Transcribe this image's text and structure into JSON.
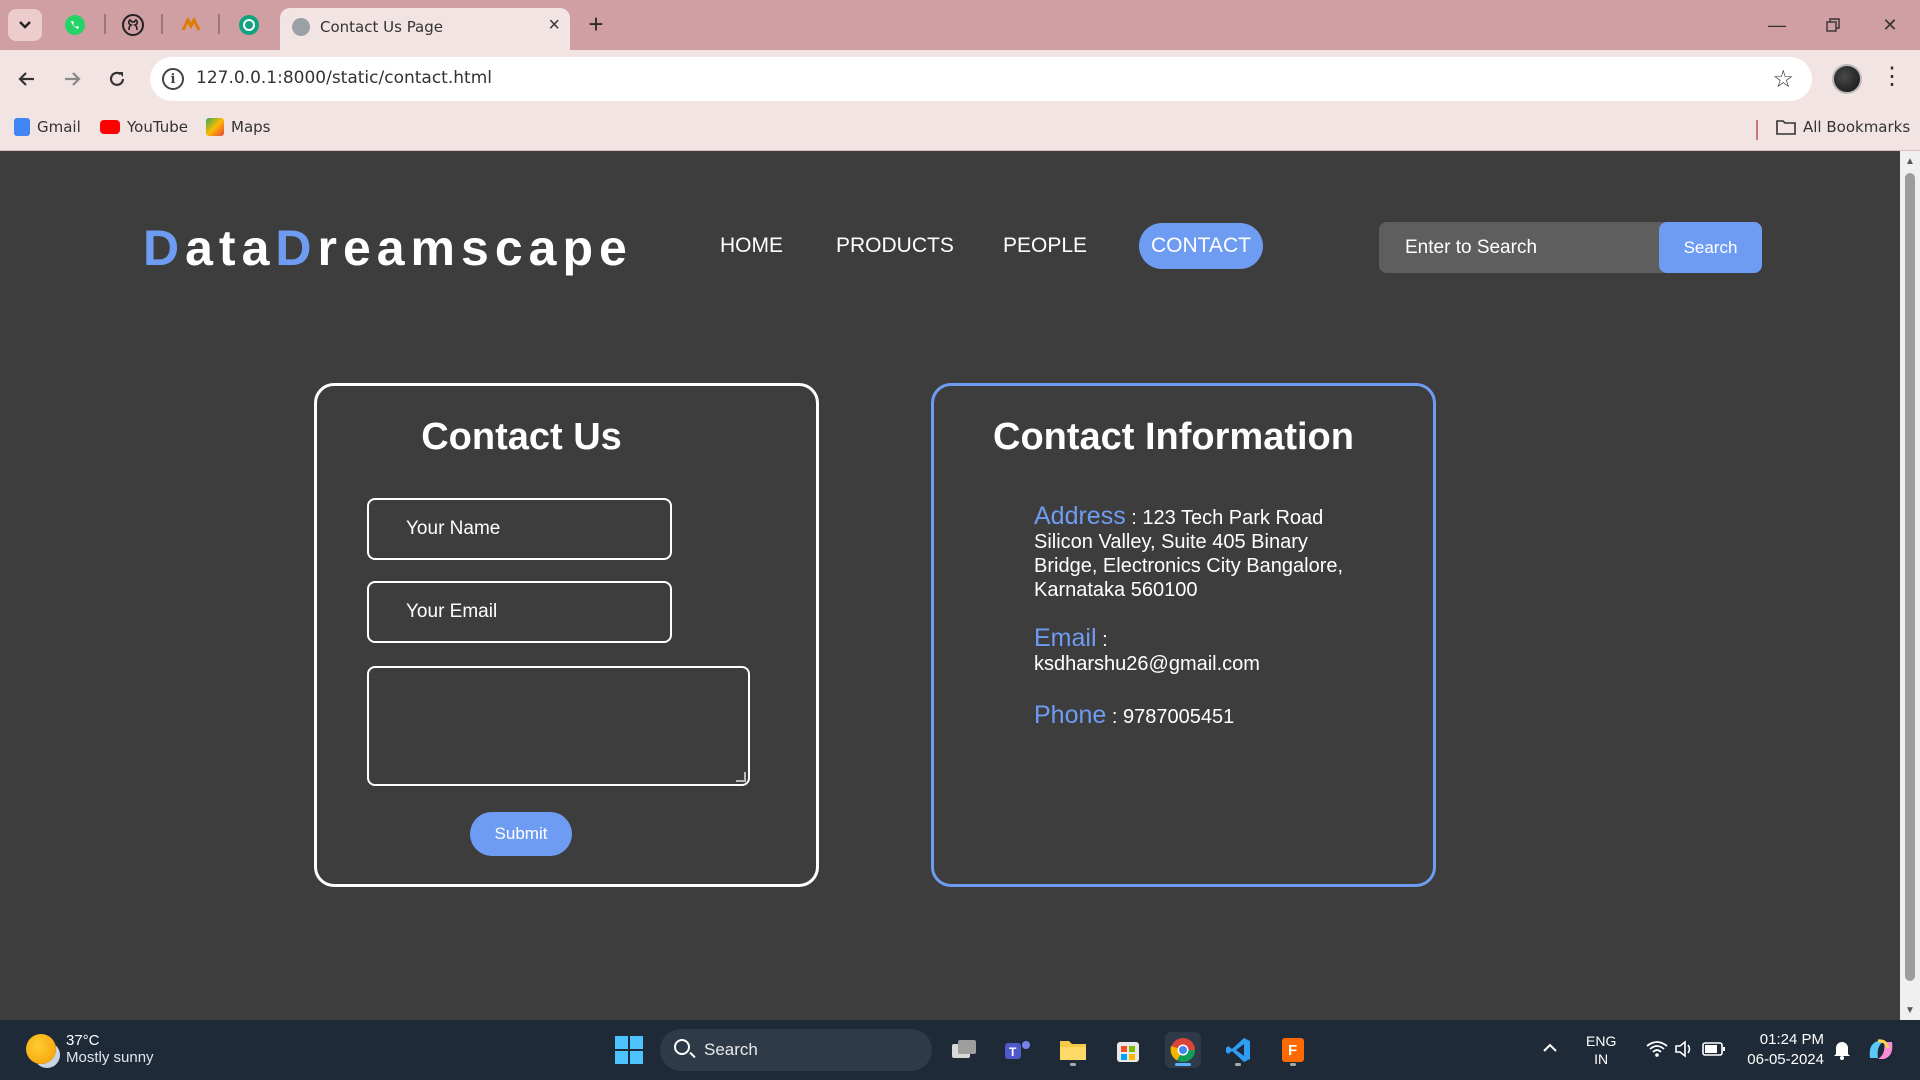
{
  "browser": {
    "tab_title": "Contact Us Page",
    "url": "127.0.0.1:8000/static/contact.html",
    "bookmarks": [
      {
        "label": "Gmail",
        "icon": "google-docs-icon",
        "color": "#4285f4"
      },
      {
        "label": "YouTube",
        "icon": "youtube-icon",
        "color": "#ff0000"
      },
      {
        "label": "Maps",
        "icon": "maps-icon",
        "color": "#34a853"
      }
    ],
    "all_bookmarks": "All Bookmarks"
  },
  "site": {
    "logo_part1_accent": "D",
    "logo_part1": "ata",
    "logo_part2_accent": "D",
    "logo_part2": "reamscape",
    "nav": [
      "HOME",
      "PRODUCTS",
      "PEOPLE",
      "CONTACT"
    ],
    "active_nav": "CONTACT",
    "search_placeholder": "Enter to Search",
    "search_button": "Search",
    "accent_color": "#6f9cf3"
  },
  "contact_form": {
    "title": "Contact Us",
    "name_placeholder": "Your Name",
    "email_placeholder": "Your Email",
    "message_placeholder": "",
    "submit_label": "Submit"
  },
  "contact_info": {
    "title": "Contact Information",
    "address_label": "Address",
    "address_value": "123 Tech Park Road Silicon Valley, Suite 405 Binary Bridge, Electronics City Bangalore, Karnataka 560100",
    "email_label": "Email",
    "email_value": "ksdharshu26@gmail.com",
    "phone_label": "Phone",
    "phone_value": "9787005451"
  },
  "taskbar": {
    "weather_temp": "37°C",
    "weather_desc": "Mostly sunny",
    "search_label": "Search",
    "lang_line1": "ENG",
    "lang_line2": "IN",
    "time": "01:24 PM",
    "date": "06-05-2024"
  }
}
